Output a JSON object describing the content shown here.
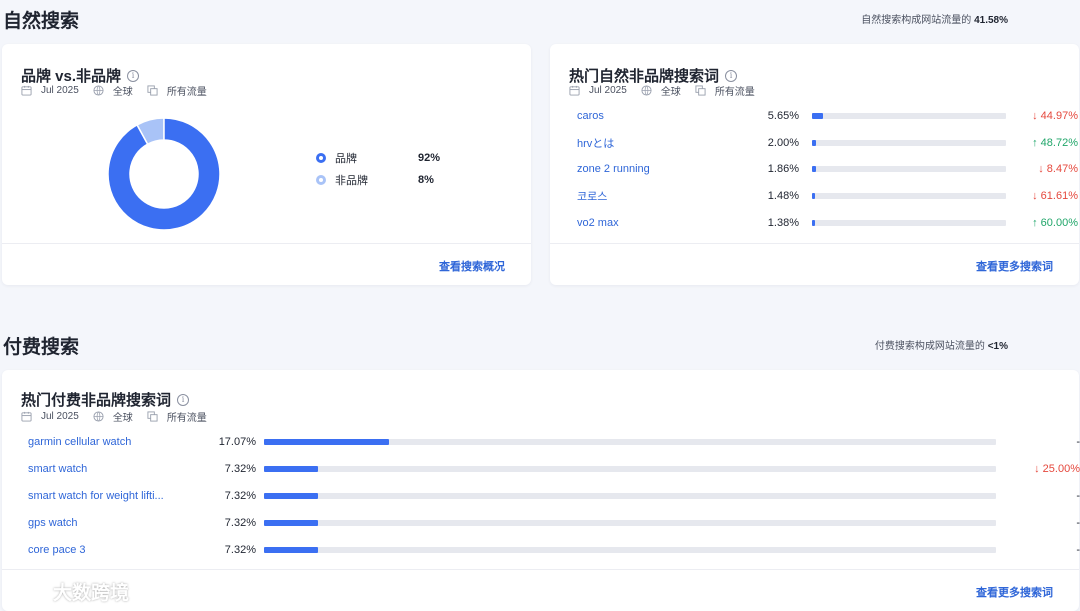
{
  "organic": {
    "title": "自然搜索",
    "note_prefix": "自然搜索构成网站流量的",
    "note_value": "41.58%"
  },
  "brand_card": {
    "title": "品牌 vs.非品牌",
    "meta": {
      "date": "Jul 2025",
      "region": "全球",
      "traffic": "所有流量"
    },
    "chart_data": {
      "type": "pie",
      "categories": [
        "品牌",
        "非品牌"
      ],
      "values": [
        92,
        8
      ],
      "colors": [
        "#3b6ff2",
        "#a9c3f7"
      ]
    },
    "legend": [
      {
        "label": "品牌",
        "value": "92%",
        "color": "#3b6ff2"
      },
      {
        "label": "非品牌",
        "value": "8%",
        "color": "#a9c3f7"
      }
    ],
    "footer_link": "查看搜索概况"
  },
  "top_organic_card": {
    "title": "热门自然非品牌搜索词",
    "meta": {
      "date": "Jul 2025",
      "region": "全球",
      "traffic": "所有流量"
    },
    "rows": [
      {
        "keyword": "caros",
        "share": "5.65%",
        "share_value": 5.65,
        "change": "44.97%",
        "direction": "down"
      },
      {
        "keyword": "hrvとは",
        "share": "2.00%",
        "share_value": 2.0,
        "change": "48.72%",
        "direction": "up"
      },
      {
        "keyword": "zone 2 running",
        "share": "1.86%",
        "share_value": 1.86,
        "change": "8.47%",
        "direction": "down"
      },
      {
        "keyword": "코로스",
        "share": "1.48%",
        "share_value": 1.48,
        "change": "61.61%",
        "direction": "down"
      },
      {
        "keyword": "vo2 max",
        "share": "1.38%",
        "share_value": 1.38,
        "change": "60.00%",
        "direction": "up"
      }
    ],
    "footer_link": "查看更多搜索词"
  },
  "paid": {
    "title": "付费搜索",
    "note_prefix": "付费搜索构成网站流量的",
    "note_value": "<1%"
  },
  "top_paid_card": {
    "title": "热门付费非品牌搜索词",
    "meta": {
      "date": "Jul 2025",
      "region": "全球",
      "traffic": "所有流量"
    },
    "rows": [
      {
        "keyword": "garmin cellular watch",
        "share": "17.07%",
        "share_value": 17.07,
        "change": "-",
        "direction": "none"
      },
      {
        "keyword": "smart watch",
        "share": "7.32%",
        "share_value": 7.32,
        "change": "25.00%",
        "direction": "down"
      },
      {
        "keyword": "smart watch for weight lifti...",
        "share": "7.32%",
        "share_value": 7.32,
        "change": "-",
        "direction": "none"
      },
      {
        "keyword": "gps watch",
        "share": "7.32%",
        "share_value": 7.32,
        "change": "-",
        "direction": "none"
      },
      {
        "keyword": "core pace 3",
        "share": "7.32%",
        "share_value": 7.32,
        "change": "-",
        "direction": "none"
      }
    ],
    "footer_link": "查看更多搜索词"
  },
  "watermark": {
    "text": "大数跨境"
  },
  "icons": {
    "calendar": "calendar-icon",
    "globe": "globe-icon",
    "traffic": "traffic-source-icon",
    "info": "info-icon"
  }
}
